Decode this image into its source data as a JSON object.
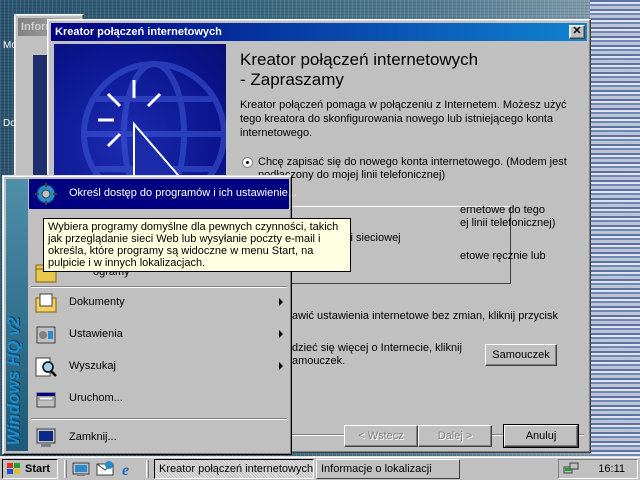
{
  "background_window": {
    "title": "Informacje o lokalizacji"
  },
  "wizard": {
    "title": "Kreator połączeń internetowych",
    "heading_line1": "Kreator połączeń internetowych",
    "heading_line2": "- Zapraszamy",
    "description": "Kreator połączeń pomaga w połączeniu z Internetem. Możesz użyć tego kreatora do skonfigurowania nowego lub istniejącego konta internetowego.",
    "option1": "Chcę zapisać się do nowego konta internetowego. (Modem jest podłączony do mojej linii telefonicznej)",
    "option2_line1": "ernetowe do tego",
    "option2_line2": "ej linii telefonicznej)",
    "option2_line3": "ci sieciowej",
    "option3": "etowe ręcznie lub",
    "info_text": "awić ustawienia internetowe bez zmian, kliknij przycisk",
    "learn_line1": "dzieć się więcej o Internecie, kliknij",
    "learn_line2": "amouczek.",
    "tutorial_button": "Samouczek",
    "back_button": "< Wstecz",
    "next_button": "Dalej >",
    "cancel_button": "Anuluj"
  },
  "start_menu": {
    "sidebar_text": "Windows HQ v2",
    "items": [
      {
        "label": "Określ dostęp do programów i ich ustawienie...",
        "icon": "settings-globe-icon"
      },
      {
        "label": "Dokumenty",
        "icon": "documents-folder-icon"
      },
      {
        "label": "Ustawienia",
        "icon": "control-panel-icon"
      },
      {
        "label": "Wyszukaj",
        "icon": "search-magnifier-icon"
      },
      {
        "label": "Uruchom...",
        "icon": "run-icon"
      },
      {
        "label": "Zamknij...",
        "icon": "shutdown-icon"
      }
    ],
    "partial_label": "ogramy",
    "tooltip": "Wybiera programy domyślne dla pewnych czynności, takich jak przeglądanie sieci Web lub wysyłanie poczty e-mail i określa, które programy są widoczne w menu Start, na pulpicie i w innych lokalizacjach."
  },
  "taskbar": {
    "start_label": "Start",
    "tasks": [
      "Kreator połączeń internetowych",
      "Informacje o lokalizacji"
    ],
    "clock": "16:11"
  },
  "desktop": {
    "left_fragments": [
      "Mo",
      "Do"
    ]
  },
  "colors": {
    "title_active": "#000080",
    "title_active_end": "#1084d0",
    "face": "#c0c0c0",
    "highlight": "#000080",
    "tooltip_bg": "#ffffe1",
    "wizard_art": "#0a148c"
  }
}
